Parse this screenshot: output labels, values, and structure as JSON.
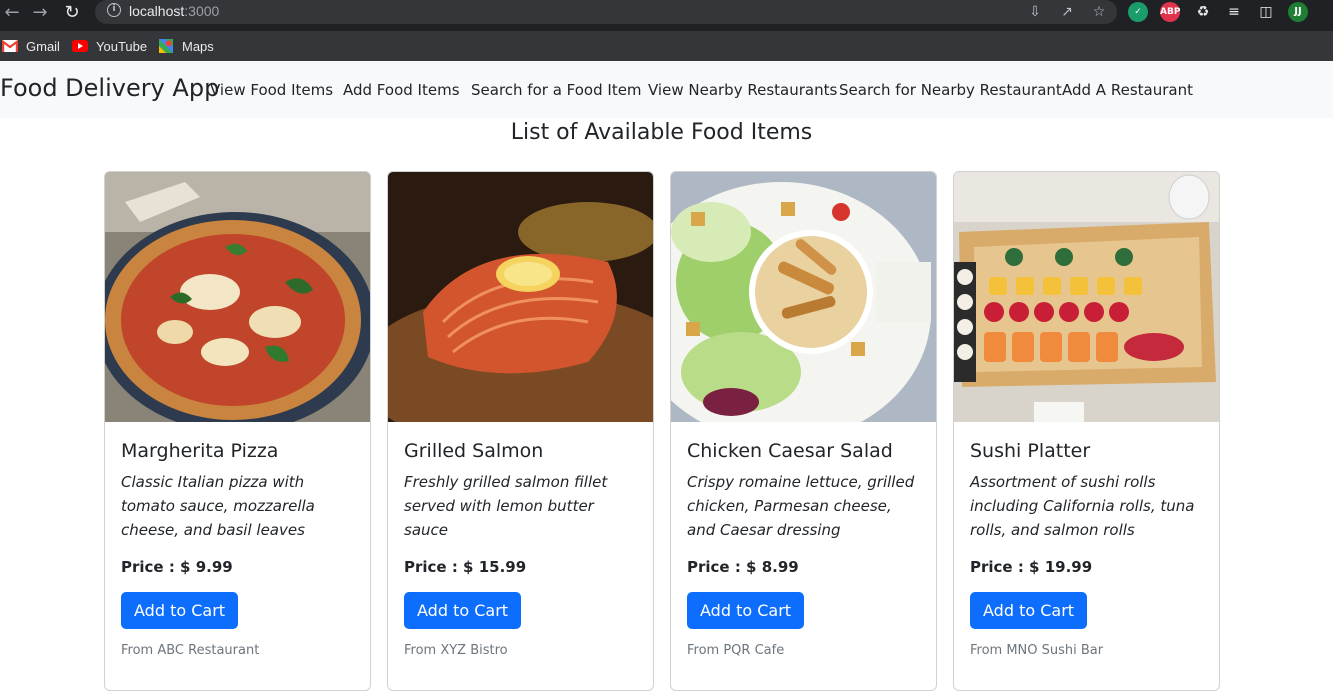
{
  "browser": {
    "url_host": "localhost",
    "url_port": ":3000",
    "profile_initials": "JJ",
    "abp_label": "ABP",
    "bookmarks": [
      {
        "label": "Gmail",
        "icon": "gmail-icon"
      },
      {
        "label": "YouTube",
        "icon": "youtube-icon"
      },
      {
        "label": "Maps",
        "icon": "maps-icon"
      }
    ]
  },
  "navbar": {
    "brand": "Food Delivery App",
    "links": [
      "View Food Items",
      "Add Food Items",
      "Search for a Food Item",
      "View Nearby Restaurants",
      "Search for Nearby Restaurant",
      "Add A Restaurant"
    ]
  },
  "page_title": "List of Available Food Items",
  "items": [
    {
      "name": "Margherita Pizza",
      "description": "Classic Italian pizza with tomato sauce, mozzarella cheese, and basil leaves",
      "price": "Price : $ 9.99",
      "button": "Add to Cart",
      "from": "From ABC Restaurant"
    },
    {
      "name": "Grilled Salmon",
      "description": "Freshly grilled salmon fillet served with lemon butter sauce",
      "price": "Price : $ 15.99",
      "button": "Add to Cart",
      "from": "From XYZ Bistro"
    },
    {
      "name": "Chicken Caesar Salad",
      "description": "Crispy romaine lettuce, grilled chicken, Parmesan cheese, and Caesar dressing",
      "price": "Price : $ 8.99",
      "button": "Add to Cart",
      "from": "From PQR Cafe"
    },
    {
      "name": "Sushi Platter",
      "description": "Assortment of sushi rolls including California rolls, tuna rolls, and salmon rolls",
      "price": "Price : $ 19.99",
      "button": "Add to Cart",
      "from": "From MNO Sushi Bar"
    }
  ],
  "colors": {
    "primary_button": "#0d6efd",
    "navbar_bg": "#f8f9fa",
    "chrome_dark": "#202124"
  }
}
